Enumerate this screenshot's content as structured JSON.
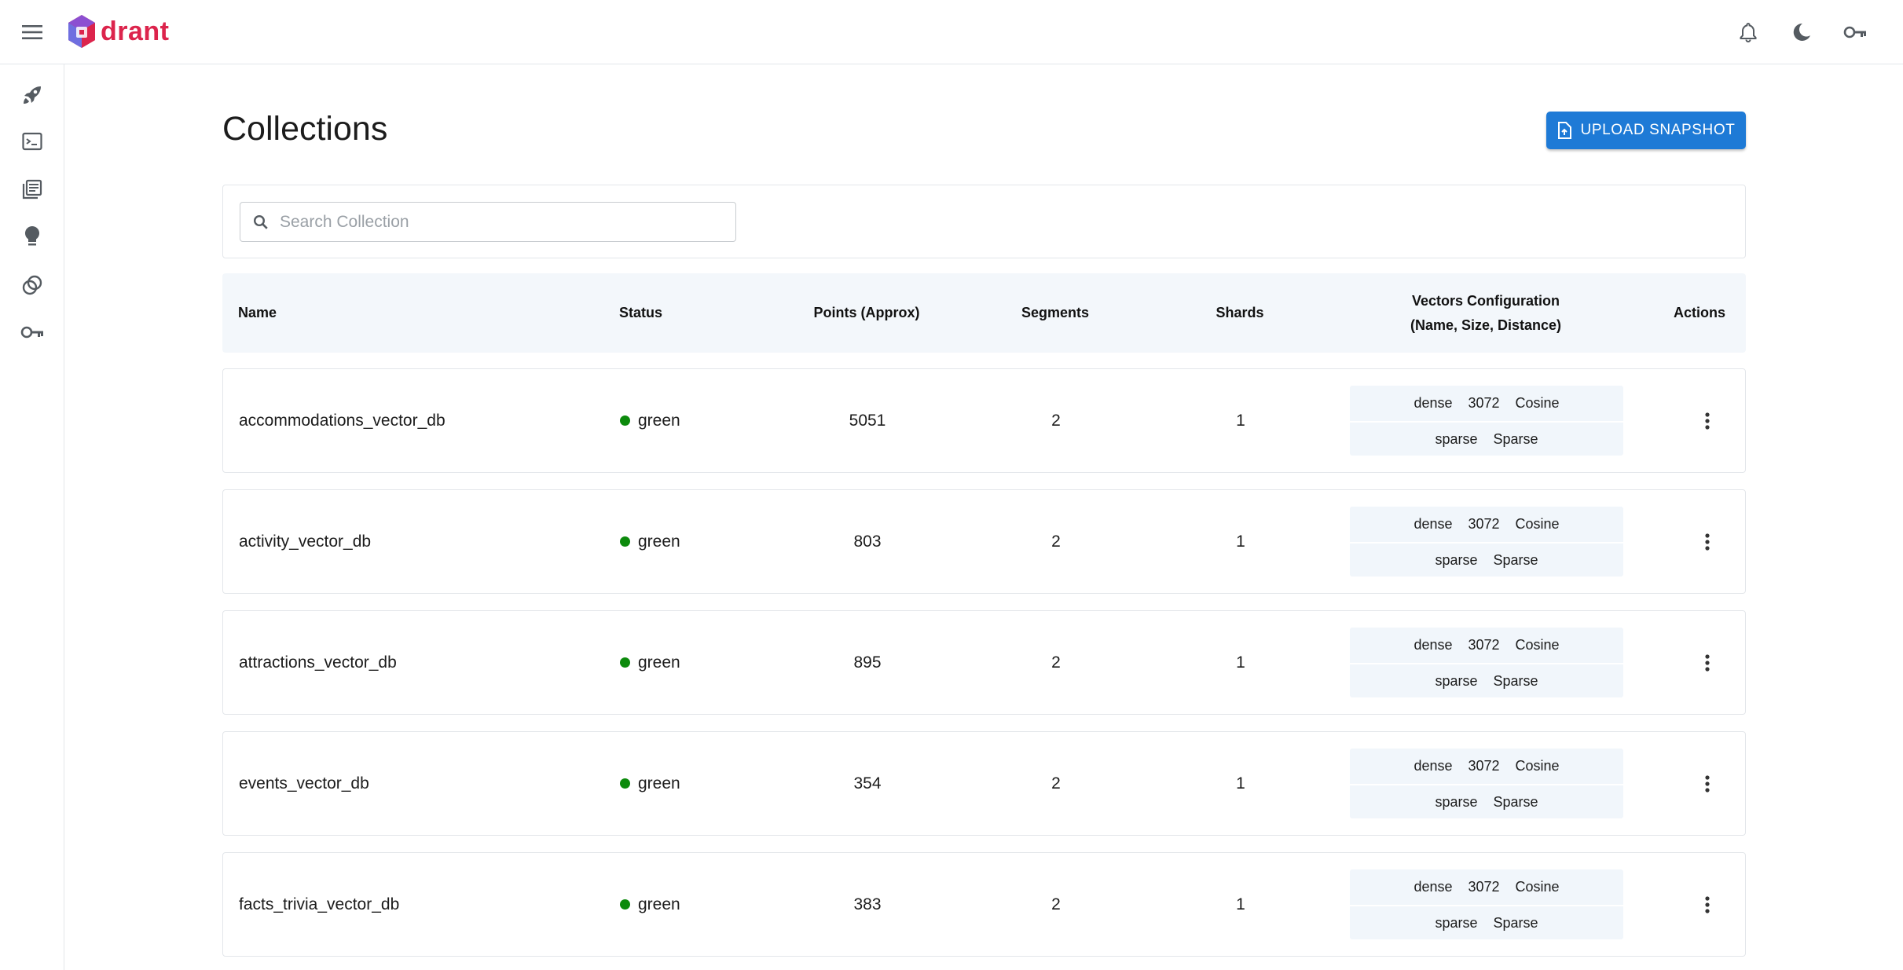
{
  "app": {
    "logo_text": "drant",
    "brand_color": "#dc244c",
    "accent_color": "#1e7ad6",
    "status_color": "#0c8a0c"
  },
  "topbar": {
    "menu_icon": "menu-icon",
    "actions": [
      {
        "icon": "bell-icon"
      },
      {
        "icon": "moon-icon"
      },
      {
        "icon": "key-icon"
      }
    ]
  },
  "sidebar": {
    "items": [
      {
        "icon": "rocket-icon"
      },
      {
        "icon": "terminal-icon"
      },
      {
        "icon": "collections-icon"
      },
      {
        "icon": "lightbulb-icon"
      },
      {
        "icon": "datasets-icon"
      },
      {
        "icon": "key-icon"
      }
    ]
  },
  "page": {
    "title": "Collections",
    "upload_label": "UPLOAD SNAPSHOT",
    "search_placeholder": "Search Collection",
    "search_value": ""
  },
  "table": {
    "headers": {
      "name": "Name",
      "status": "Status",
      "points": "Points (Approx)",
      "segments": "Segments",
      "shards": "Shards",
      "vectors_line1": "Vectors Configuration",
      "vectors_line2": "(Name, Size, Distance)",
      "actions": "Actions"
    },
    "rows": [
      {
        "name": "accommodations_vector_db",
        "status": "green",
        "points": "5051",
        "segments": "2",
        "shards": "1",
        "vectors": [
          {
            "name": "dense",
            "size": "3072",
            "distance": "Cosine"
          },
          {
            "name": "sparse",
            "size": "",
            "distance": "Sparse"
          }
        ]
      },
      {
        "name": "activity_vector_db",
        "status": "green",
        "points": "803",
        "segments": "2",
        "shards": "1",
        "vectors": [
          {
            "name": "dense",
            "size": "3072",
            "distance": "Cosine"
          },
          {
            "name": "sparse",
            "size": "",
            "distance": "Sparse"
          }
        ]
      },
      {
        "name": "attractions_vector_db",
        "status": "green",
        "points": "895",
        "segments": "2",
        "shards": "1",
        "vectors": [
          {
            "name": "dense",
            "size": "3072",
            "distance": "Cosine"
          },
          {
            "name": "sparse",
            "size": "",
            "distance": "Sparse"
          }
        ]
      },
      {
        "name": "events_vector_db",
        "status": "green",
        "points": "354",
        "segments": "2",
        "shards": "1",
        "vectors": [
          {
            "name": "dense",
            "size": "3072",
            "distance": "Cosine"
          },
          {
            "name": "sparse",
            "size": "",
            "distance": "Sparse"
          }
        ]
      },
      {
        "name": "facts_trivia_vector_db",
        "status": "green",
        "points": "383",
        "segments": "2",
        "shards": "1",
        "vectors": [
          {
            "name": "dense",
            "size": "3072",
            "distance": "Cosine"
          },
          {
            "name": "sparse",
            "size": "",
            "distance": "Sparse"
          }
        ]
      }
    ]
  }
}
